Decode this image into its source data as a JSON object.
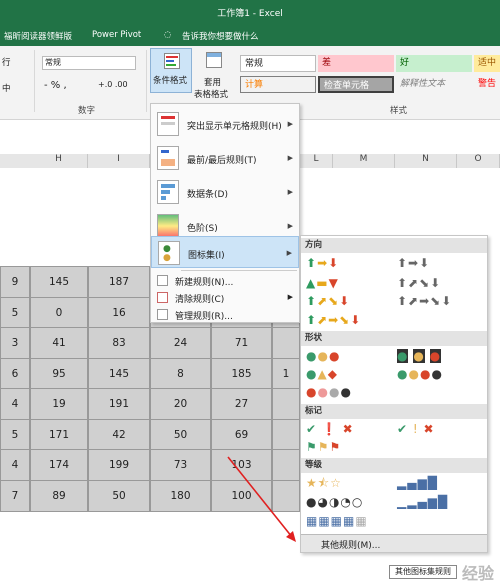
{
  "title": "工作簿1 - Excel",
  "tabs": [
    "福昕阅读器领鲜版",
    "Power Pivot",
    "告诉我你想要做什么"
  ],
  "ribbon": {
    "font_fragment": "行",
    "number_format": "常规",
    "currency": "- % ,",
    "decimal": "+.0 .00",
    "number_group": "数字",
    "cond_format": "条件格式",
    "table_format_line1": "套用",
    "table_format_line2": "表格格式",
    "styles_group": "样式",
    "center_fragment": "中",
    "styles": {
      "normal": "常规",
      "bad": "差",
      "good": "好",
      "neutral": "适中",
      "calc": "计算",
      "check": "检查单元格",
      "explain": "解释性文本",
      "warning": "警告"
    }
  },
  "columns": [
    "H",
    "I",
    "L",
    "M",
    "N",
    "O"
  ],
  "rows": [
    [
      "9",
      "145",
      "187",
      "",
      "",
      ""
    ],
    [
      "5",
      "0",
      "16",
      "",
      "",
      ""
    ],
    [
      "3",
      "41",
      "83",
      "24",
      "71",
      ""
    ],
    [
      "6",
      "95",
      "145",
      "8",
      "185",
      "1"
    ],
    [
      "4",
      "19",
      "191",
      "20",
      "27",
      ""
    ],
    [
      "5",
      "171",
      "42",
      "50",
      "69",
      ""
    ],
    [
      "4",
      "174",
      "199",
      "73",
      "103",
      ""
    ],
    [
      "7",
      "89",
      "50",
      "180",
      "100",
      ""
    ]
  ],
  "menu": {
    "items": [
      {
        "label": "突出显示单元格规则(H)",
        "icon": "highlight-rules-icon"
      },
      {
        "label": "最前/最后规则(T)",
        "icon": "top-bottom-rules-icon"
      },
      {
        "label": "数据条(D)",
        "icon": "data-bars-icon"
      },
      {
        "label": "色阶(S)",
        "icon": "color-scales-icon"
      },
      {
        "label": "图标集(I)",
        "icon": "icon-sets-icon"
      }
    ],
    "small_items": [
      {
        "label": "新建规则(N)...",
        "icon": "new-rule-icon"
      },
      {
        "label": "清除规则(C)",
        "icon": "clear-rules-icon"
      },
      {
        "label": "管理规则(R)...",
        "icon": "manage-rules-icon"
      }
    ]
  },
  "submenu": {
    "sections": [
      "方向",
      "形状",
      "标记",
      "等级"
    ],
    "more": "其他规则(M)...",
    "tooltip": "其他图标集规则"
  },
  "colors": {
    "excel_green": "#217346",
    "bad_bg": "#ffc7ce",
    "good_bg": "#c6efce",
    "neutral_bg": "#ffeb9c",
    "check_bg": "#a5a5a5"
  },
  "watermark": "经验"
}
